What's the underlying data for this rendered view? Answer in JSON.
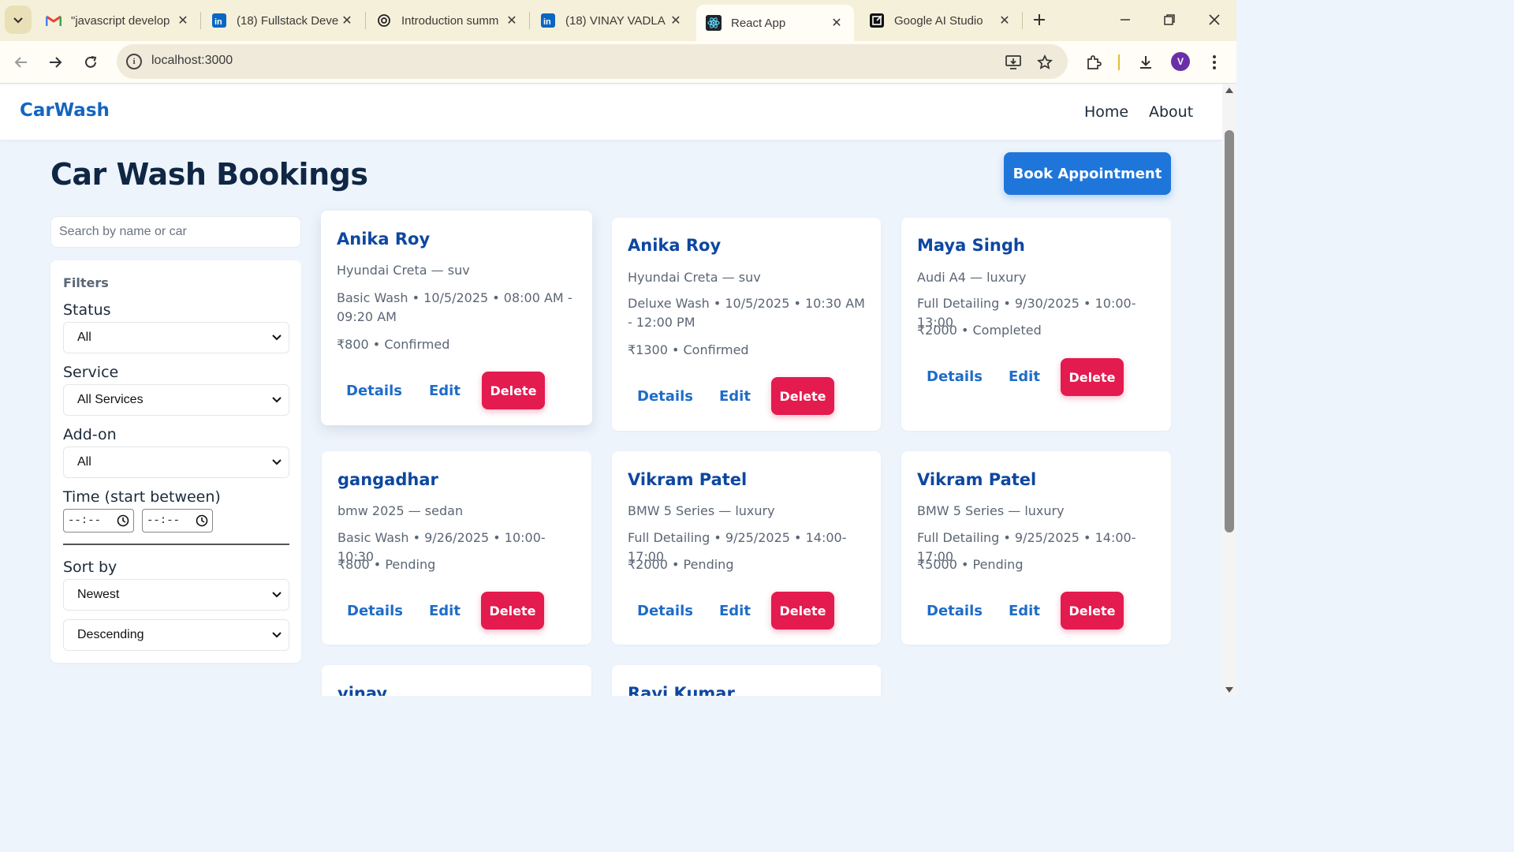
{
  "browser": {
    "tabs": [
      {
        "title": "\"javascript develop",
        "icon": "gmail-icon"
      },
      {
        "title": "(18) Fullstack Deve",
        "icon": "linkedin-icon"
      },
      {
        "title": "Introduction summ",
        "icon": "chatgpt-icon"
      },
      {
        "title": "(18) VINAY VADLA",
        "icon": "linkedin-icon"
      },
      {
        "title": "React App",
        "icon": "react-icon",
        "active": true
      },
      {
        "title": "Google AI Studio",
        "icon": "ai-studio-icon"
      }
    ],
    "url": "localhost:3000",
    "profile_initial": "V"
  },
  "header": {
    "brand": "CarWash",
    "nav": [
      "Home",
      "About"
    ]
  },
  "page": {
    "title": "Car Wash Bookings",
    "book_button": "Book Appointment"
  },
  "search": {
    "placeholder": "Search by name or car"
  },
  "filters": {
    "heading": "Filters",
    "status_label": "Status",
    "status_value": "All",
    "service_label": "Service",
    "service_value": "All Services",
    "addon_label": "Add-on",
    "addon_value": "All",
    "time_label": "Time (start between)",
    "time_from": "--:--",
    "time_to": "--:--",
    "sort_label": "Sort by",
    "sort_value": "Newest",
    "order_value": "Descending"
  },
  "bookings": [
    {
      "name": "Anika Roy",
      "car": "Hyundai Creta — suv",
      "service": "Basic Wash • 10/5/2025 • 08:00 AM - 09:20 AM",
      "price": "₹800 • Confirmed",
      "details": "Details",
      "edit": "Edit",
      "delete": "Delete"
    },
    {
      "name": "Anika Roy",
      "car": "Hyundai Creta — suv",
      "service": "Deluxe Wash • 10/5/2025 • 10:30 AM - 12:00 PM",
      "price": "₹1300 • Confirmed",
      "details": "Details",
      "edit": "Edit",
      "delete": "Delete"
    },
    {
      "name": "Maya Singh",
      "car": "Audi A4 — luxury",
      "service": "Full Detailing • 9/30/2025 • 10:00-13:00",
      "price": "₹2000 • Completed",
      "details": "Details",
      "edit": "Edit",
      "delete": "Delete"
    },
    {
      "name": "gangadhar",
      "car": "bmw 2025 — sedan",
      "service": "Basic Wash • 9/26/2025 • 10:00-10:30",
      "price": "₹800 • Pending",
      "details": "Details",
      "edit": "Edit",
      "delete": "Delete"
    },
    {
      "name": "Vikram Patel",
      "car": "BMW 5 Series — luxury",
      "service": "Full Detailing • 9/25/2025 • 14:00-17:00",
      "price": "₹2000 • Pending",
      "details": "Details",
      "edit": "Edit",
      "delete": "Delete"
    },
    {
      "name": "Vikram Patel",
      "car": "BMW 5 Series — luxury",
      "service": "Full Detailing • 9/25/2025 • 14:00-17:00",
      "price": "₹5000 • Pending",
      "details": "Details",
      "edit": "Edit",
      "delete": "Delete"
    },
    {
      "name": "vinay"
    },
    {
      "name": "Ravi Kumar"
    }
  ],
  "colors": {
    "brand": "#1565c0",
    "primary_button": "#1e76db",
    "delete_button": "#e31b4f",
    "page_background": "#eef4fb"
  }
}
